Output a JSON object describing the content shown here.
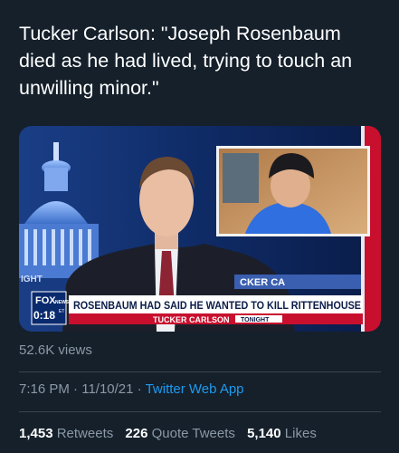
{
  "tweet": {
    "text": "Tucker Carlson: \"Joseph Rosenbaum died as he had lived, trying to touch an unwilling minor.\""
  },
  "media": {
    "lower_third_headline": "ROSENBAUM HAD SAID HE WANTED TO KILL RITTENHOUSE",
    "show_host": "TUCKER CARLSON",
    "show_name": "TONIGHT",
    "bug_network": "FOX",
    "bug_sub": "NEWS",
    "bug_time": "0:18",
    "bug_sup": "ET",
    "ticker_fragment": "CKER CA",
    "side_fragment": "IGHT",
    "colors": {
      "fox_red": "#c8102e",
      "fox_blue": "#0a2a6e",
      "accent": "#1d9bf0"
    }
  },
  "stats": {
    "views": "52.6K views",
    "time": "7:16 PM",
    "sep": "·",
    "date": "11/10/21",
    "app": "Twitter Web App",
    "retweets_count": "1,453",
    "retweets_label": "Retweets",
    "quotes_count": "226",
    "quotes_label": "Quote Tweets",
    "likes_count": "5,140",
    "likes_label": "Likes"
  }
}
